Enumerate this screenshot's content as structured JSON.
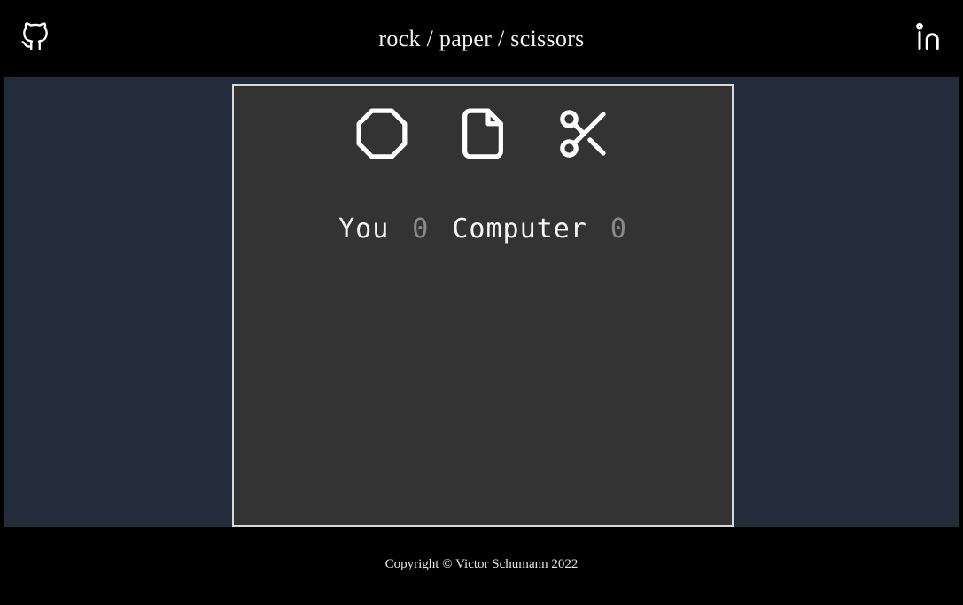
{
  "header": {
    "title": "rock / paper / scissors",
    "github_icon": "github-octocat-icon",
    "github_label": "GitHub",
    "linkedin_icon": "linkedin-in-icon",
    "linkedin_label": "LinkedIn"
  },
  "game": {
    "choices": [
      {
        "id": "rock",
        "label": "Rock",
        "icon": "octagon-rock-icon"
      },
      {
        "id": "paper",
        "label": "Paper",
        "icon": "document-paper-icon"
      },
      {
        "id": "scissors",
        "label": "Scissors",
        "icon": "scissors-icon"
      }
    ],
    "score": {
      "player_label": "You",
      "player_value": "0",
      "computer_label": "Computer",
      "computer_value": "0"
    },
    "result_message": ""
  },
  "footer": {
    "copyright": "Copyright © Victor Schumann 2022"
  },
  "colors": {
    "page_background": "#232c3b",
    "header_background": "#000000",
    "footer_background": "#000000",
    "panel_background": "#333333",
    "panel_border": "#d8d8d8",
    "text_primary": "#f4f4f4",
    "score_value": "#8a8a8a"
  }
}
